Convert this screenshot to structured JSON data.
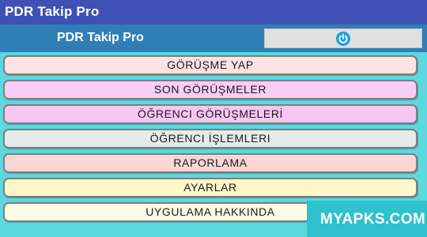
{
  "app_bar": {
    "title": "PDR Takip Pro",
    "background": "#3f51b5"
  },
  "header": {
    "title": "PDR Takip Pro",
    "background": "#2f7fb7",
    "power_button": {
      "icon": "power-icon",
      "icon_color": "#1fa0d8"
    }
  },
  "menu": {
    "items": [
      {
        "label": "GÖRÜŞME YAP",
        "color": "#fde3e3"
      },
      {
        "label": "SON GÖRÜŞMELER",
        "color": "#f8cdf6"
      },
      {
        "label": "ÖĞRENCI GÖRÜŞMELERİ",
        "color": "#f8c6f3"
      },
      {
        "label": "ÖĞRENCI İŞLEMLERI",
        "color": "#e5eaea"
      },
      {
        "label": "RAPORLAMA",
        "color": "#fcd5d5"
      },
      {
        "label": "AYARLAR",
        "color": "#fff7c8"
      },
      {
        "label": "UYGULAMA HAKKINDA",
        "color": "#fbfbe6"
      }
    ]
  },
  "watermark": {
    "text": "MYAPKS.COM",
    "background": "#2ec1ce"
  }
}
